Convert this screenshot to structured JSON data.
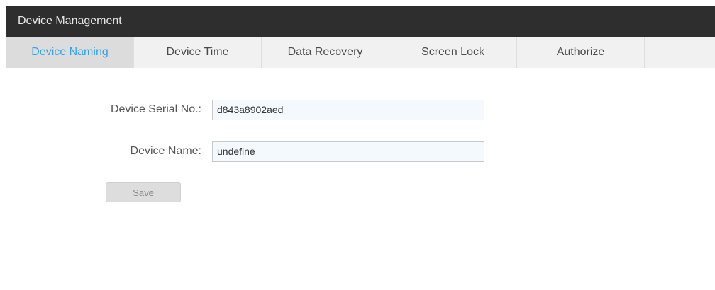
{
  "window": {
    "title": "Device Management"
  },
  "tabs": [
    {
      "label": "Device Naming",
      "active": true
    },
    {
      "label": "Device Time",
      "active": false
    },
    {
      "label": "Data Recovery",
      "active": false
    },
    {
      "label": "Screen Lock",
      "active": false
    },
    {
      "label": "Authorize",
      "active": false
    }
  ],
  "form": {
    "serial": {
      "label": "Device Serial No.:",
      "value": "d843a8902aed"
    },
    "name": {
      "label": "Device Name:",
      "value": "undefine"
    },
    "save_label": "Save"
  },
  "colors": {
    "titlebar_bg": "#2e2e2e",
    "active_tab_text": "#2fa4e7",
    "tabbar_bg": "#f1f1f1",
    "active_tab_bg": "#dcdcdc"
  }
}
